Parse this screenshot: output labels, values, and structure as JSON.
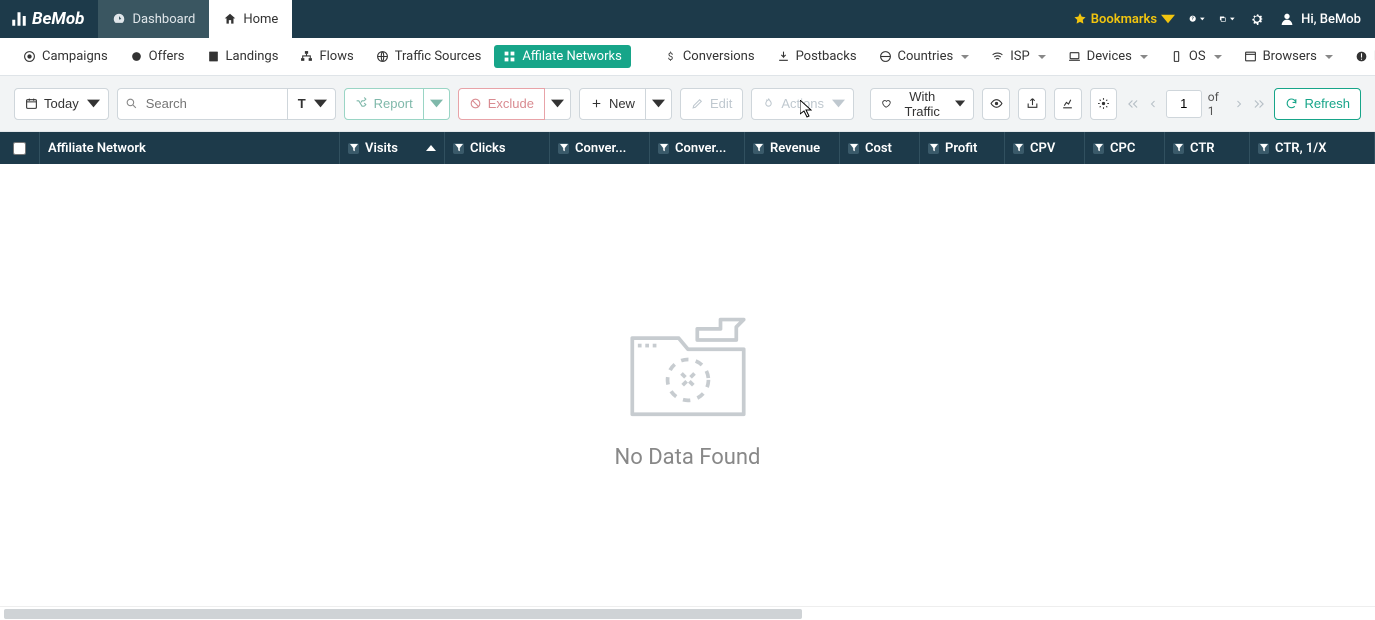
{
  "brand": "BeMob",
  "top_tabs": {
    "dashboard": "Dashboard",
    "home": "Home"
  },
  "header": {
    "bookmarks": "Bookmarks",
    "greeting": "Hi, BeMob"
  },
  "nav": {
    "campaigns": "Campaigns",
    "offers": "Offers",
    "landings": "Landings",
    "flows": "Flows",
    "traffic_sources": "Traffic Sources",
    "affiliate_networks": "Affilate Networks",
    "conversions": "Conversions",
    "postbacks": "Postbacks",
    "countries": "Countries",
    "isp": "ISP",
    "devices": "Devices",
    "os": "OS",
    "browsers": "Browsers",
    "errors": "Errors"
  },
  "toolbar": {
    "today": "Today",
    "search_placeholder": "Search",
    "type_label": "T",
    "report": "Report",
    "exclude": "Exclude",
    "new": "New",
    "edit": "Edit",
    "actions": "Actions",
    "with_traffic": "With Traffic",
    "refresh": "Refresh",
    "page_current": "1",
    "page_total": "of 1"
  },
  "columns": {
    "affiliate_network": "Affiliate Network",
    "visits": "Visits",
    "clicks": "Clicks",
    "conversions": "Conver...",
    "conversion_rate": "Conver...",
    "revenue": "Revenue",
    "cost": "Cost",
    "profit": "Profit",
    "cpv": "CPV",
    "cpc": "CPC",
    "ctr": "CTR",
    "ctr_1x": "CTR, 1/X"
  },
  "empty": {
    "message": "No Data Found"
  }
}
